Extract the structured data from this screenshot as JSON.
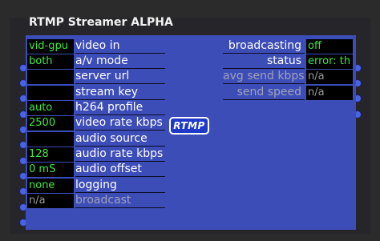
{
  "module": {
    "title": "RTMP Streamer ALPHA",
    "logo_text": "RTMP"
  },
  "inputs": [
    {
      "label": "video in",
      "value": "vid-gpu"
    },
    {
      "label": "a/v mode",
      "value": "both"
    },
    {
      "label": "server url",
      "value": ""
    },
    {
      "label": "stream key",
      "value": ""
    },
    {
      "label": "h264 profile",
      "value": "auto"
    },
    {
      "label": "video rate kbps",
      "value": "2500"
    },
    {
      "label": "audio source",
      "value": ""
    },
    {
      "label": "audio rate kbps",
      "value": "128"
    },
    {
      "label": "audio offset",
      "value": "0 mS"
    },
    {
      "label": "logging",
      "value": "none"
    },
    {
      "label": "broadcast",
      "value": "n/a"
    }
  ],
  "outputs": [
    {
      "label": "broadcasting",
      "value": "off"
    },
    {
      "label": "status",
      "value": "error: th"
    },
    {
      "label": "avg send kbps",
      "value": "n/a"
    },
    {
      "label": "send speed",
      "value": "n/a"
    }
  ],
  "colors": {
    "panel": "#3d4db8",
    "value_text": "#3ee83e",
    "value_bg": "#000000",
    "port": "#4a62e6"
  }
}
